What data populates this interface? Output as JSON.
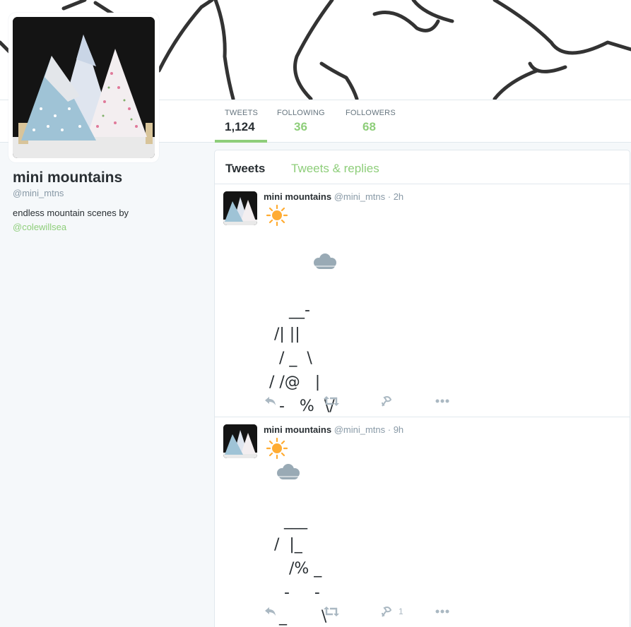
{
  "profile": {
    "name": "mini mountains",
    "handle": "@mini_mtns",
    "bio_text": "endless mountain scenes by",
    "bio_link": "@colewillsea"
  },
  "stats": [
    {
      "label": "TWEETS",
      "value": "1,124"
    },
    {
      "label": "FOLLOWING",
      "value": "36"
    },
    {
      "label": "FOLLOWERS",
      "value": "68"
    }
  ],
  "tabs": {
    "tweets": "Tweets",
    "replies": "Tweets & replies"
  },
  "tweets": [
    {
      "name": "mini mountains",
      "handle": "@mini_mtns",
      "time": "· 2h",
      "lines": [
        "",
        "",
        "",
        "     __-",
        "  /| ||",
        "   / _  \\",
        " / /@   |",
        "   -   %  \\/"
      ],
      "retweets": "",
      "likes": ""
    },
    {
      "name": "mini mountains",
      "handle": "@mini_mtns",
      "time": "· 9h",
      "lines": [
        "",
        "",
        "    ___",
        "  /  |_",
        "     /% _",
        "    -     -",
        "   _       \\"
      ],
      "retweets": "",
      "likes": "1"
    }
  ],
  "colors": {
    "accent": "#8ece7a",
    "muted": "#8899a6",
    "sun": "#ffac33",
    "cloud": "#99aab5"
  },
  "icons": [
    "reply-icon",
    "retweet-icon",
    "like-icon",
    "more-icon",
    "sun-icon",
    "cloud-icon"
  ]
}
